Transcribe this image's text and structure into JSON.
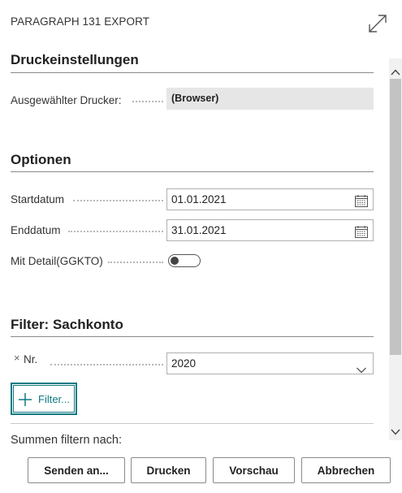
{
  "dialog": {
    "title": "PARAGRAPH 131 EXPORT"
  },
  "druck": {
    "heading": "Druckeinstellungen",
    "printer_label": "Ausgewählter Drucker:",
    "printer_value": "(Browser)"
  },
  "optionen": {
    "heading": "Optionen",
    "start_label": "Startdatum",
    "start_value": "01.01.2021",
    "end_label": "Enddatum",
    "end_value": "31.01.2021",
    "detail_label": "Mit Detail(GGKTO)",
    "detail_on": false
  },
  "filter": {
    "heading": "Filter: Sachkonto",
    "remove_glyph": "×",
    "nr_label": "Nr.",
    "nr_value": "2020",
    "add_filter_label": "Filter...",
    "summen_label": "Summen filtern nach:"
  },
  "buttons": {
    "send": "Senden an...",
    "print": "Drucken",
    "preview": "Vorschau",
    "cancel": "Abbrechen"
  },
  "icons": {
    "expand": "expand-icon",
    "calendar": "calendar-icon",
    "chevron": "chevron-down-icon",
    "plus": "plus-icon"
  },
  "colors": {
    "accent": "#0e7a82"
  }
}
